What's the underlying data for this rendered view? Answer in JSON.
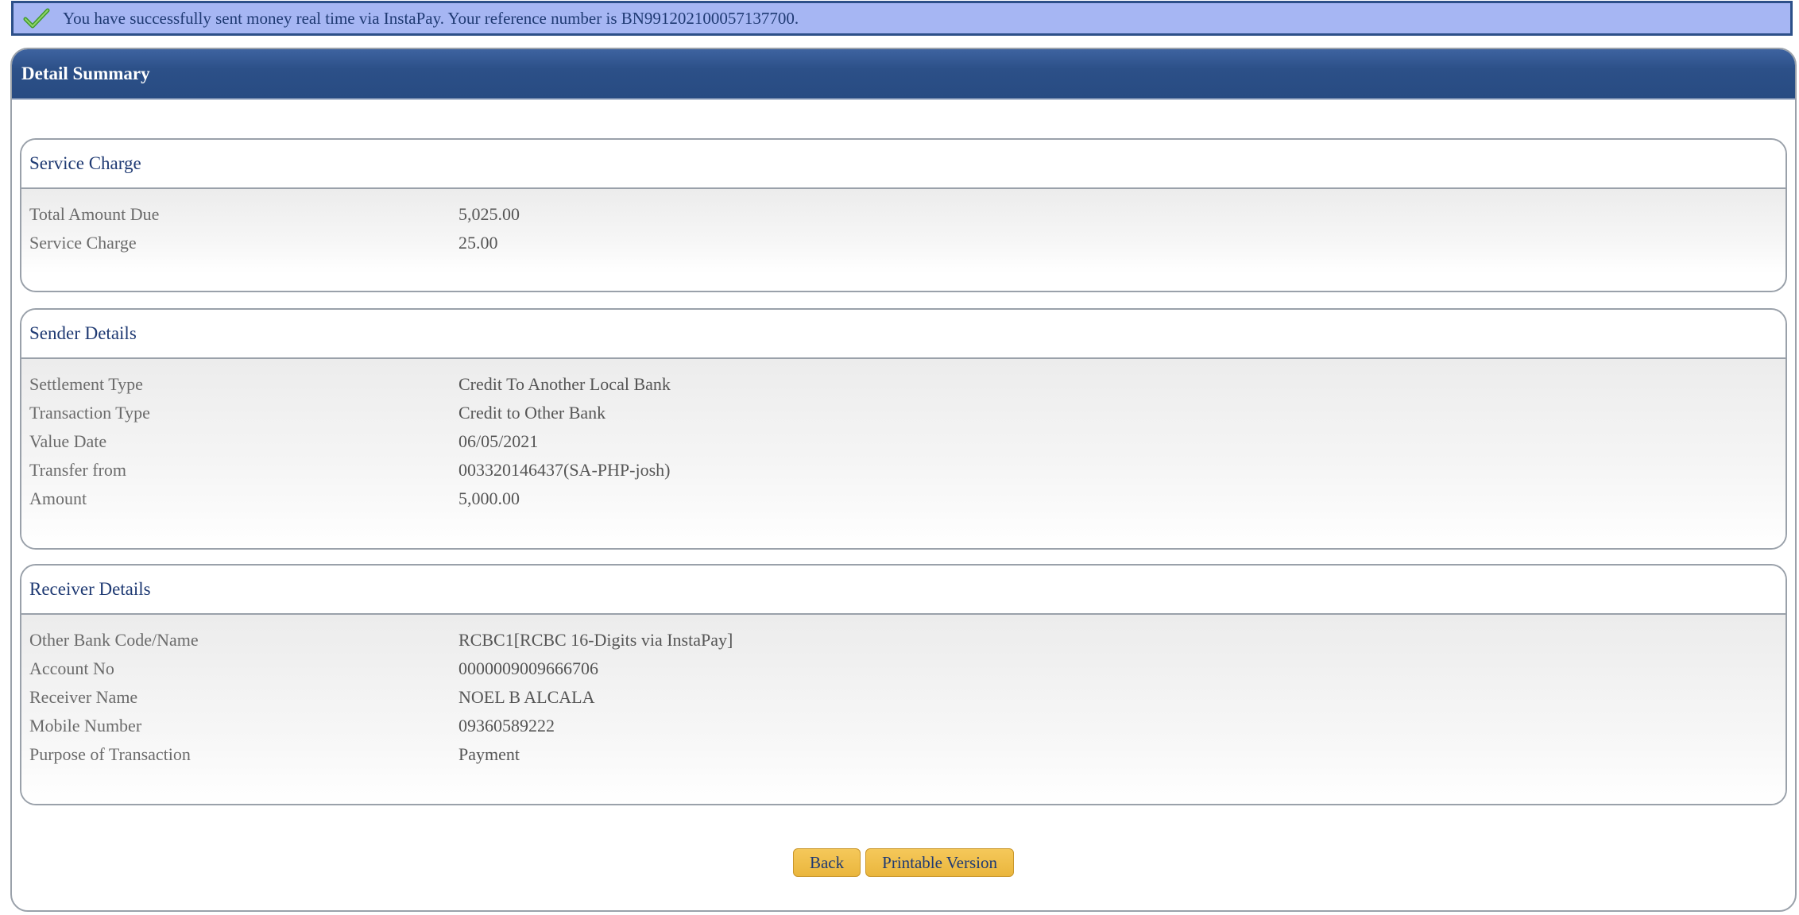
{
  "banner": {
    "message": "You have successfully sent money real time via InstaPay. Your reference number is BN991202100057137700.",
    "icon": "check-icon",
    "color": "#a6b6f3",
    "border_color": "#2c4f88"
  },
  "panel": {
    "title": "Detail Summary",
    "header_color": "#2c5088"
  },
  "service_charge": {
    "title": "Service Charge",
    "rows": [
      {
        "label": "Total Amount Due",
        "value": "5,025.00"
      },
      {
        "label": "Service Charge",
        "value": "25.00"
      }
    ]
  },
  "sender_details": {
    "title": "Sender Details",
    "rows": [
      {
        "label": "Settlement Type",
        "value": "Credit To Another Local Bank"
      },
      {
        "label": "Transaction Type",
        "value": "Credit to Other Bank"
      },
      {
        "label": "Value Date",
        "value": "06/05/2021"
      },
      {
        "label": "Transfer from",
        "value": "003320146437(SA-PHP-josh)"
      },
      {
        "label": "Amount",
        "value": "5,000.00"
      }
    ]
  },
  "receiver_details": {
    "title": "Receiver Details",
    "rows": [
      {
        "label": "Other Bank Code/Name",
        "value": "RCBC1[RCBC 16-Digits via InstaPay]"
      },
      {
        "label": "Account No",
        "value": "0000009009666706"
      },
      {
        "label": "Receiver Name",
        "value": "NOEL B ALCALA"
      },
      {
        "label": "Mobile Number",
        "value": "09360589222"
      },
      {
        "label": "Purpose of Transaction",
        "value": "Payment"
      }
    ]
  },
  "buttons": {
    "back_label": "Back",
    "printable_label": "Printable Version",
    "color": "#f0bd48"
  }
}
